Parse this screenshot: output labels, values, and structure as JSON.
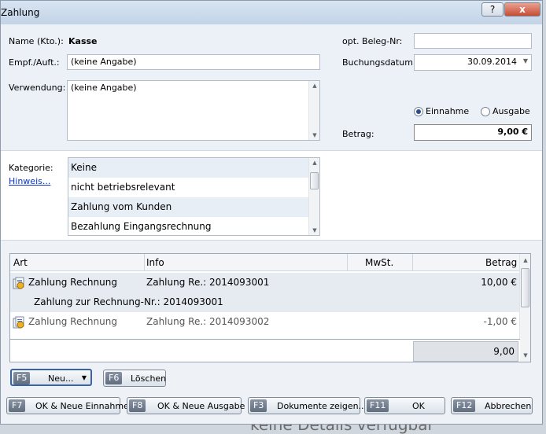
{
  "window": {
    "title": "Zahlung",
    "help_label": "?",
    "close_label": "x"
  },
  "form": {
    "name_label": "Name (Kto.):",
    "name_value": "Kasse",
    "recipient_label": "Empf./Auft.:",
    "recipient_value": "(keine Angabe)",
    "purpose_label": "Verwendung:",
    "purpose_value": "(keine Angabe)",
    "receipt_label": "opt. Beleg-Nr:",
    "receipt_value": "",
    "date_label": "Buchungsdatum:",
    "date_value": "30.09.2014",
    "income_label": "Einnahme",
    "expense_label": "Ausgabe",
    "amount_label": "Betrag:",
    "amount_value": "9,00 €"
  },
  "category": {
    "label": "Kategorie:",
    "hint_link": "Hinweis...",
    "items": [
      "Keine",
      "nicht betriebsrelevant",
      "Zahlung vom Kunden",
      "Bezahlung Eingangsrechnung"
    ]
  },
  "table": {
    "columns": [
      "Art",
      "Info",
      "MwSt.",
      "Betrag"
    ],
    "rows": [
      {
        "art": "Zahlung Rechnung",
        "info": "Zahlung Re.: 2014093001",
        "mwst": "",
        "betrag": "10,00 €"
      },
      {
        "detail": "Zahlung zur Rechnung-Nr.: 2014093001"
      },
      {
        "art": "Zahlung Rechnung",
        "info": "Zahlung Re.: 2014093002",
        "mwst": "",
        "betrag": "-1,00 €"
      }
    ],
    "total": "9,00"
  },
  "actions": {
    "new_key": "F5",
    "new_label": "Neu...",
    "delete_key": "F6",
    "delete_label": "Löschen"
  },
  "footer": {
    "buttons": [
      {
        "key": "F7",
        "label": "OK & Neue Einnahme"
      },
      {
        "key": "F8",
        "label": "OK & Neue Ausgabe"
      },
      {
        "key": "F3",
        "label": "Dokumente zeigen..."
      },
      {
        "key": "F11",
        "label": "OK"
      },
      {
        "key": "F12",
        "label": "Abbrechen"
      }
    ]
  },
  "background": {
    "text": "keine Details verfügbar"
  }
}
